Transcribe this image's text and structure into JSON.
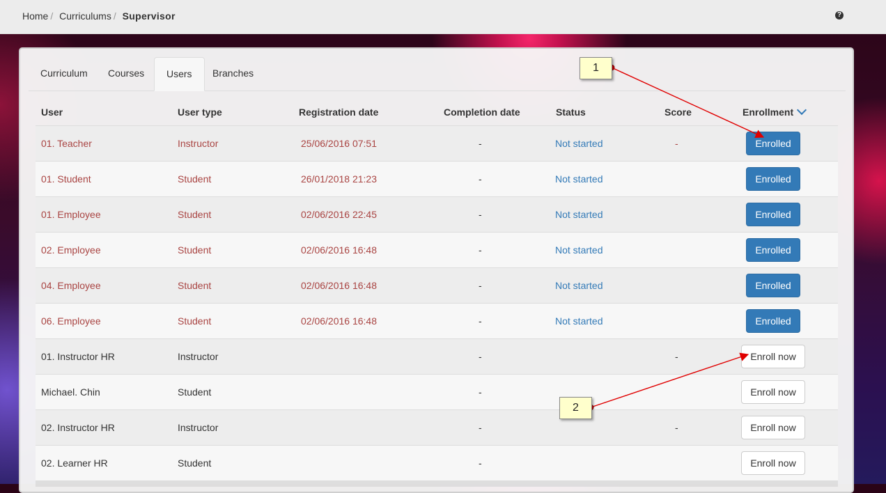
{
  "breadcrumb": {
    "home": "Home",
    "curriculums": "Curriculums",
    "current": "Supervisor"
  },
  "help_icon": "question-circle-icon",
  "tabs": [
    {
      "label": "Curriculum",
      "active": false
    },
    {
      "label": "Courses",
      "active": false
    },
    {
      "label": "Users",
      "active": true
    },
    {
      "label": "Branches",
      "active": false
    }
  ],
  "table": {
    "headers": {
      "user": "User",
      "type": "User type",
      "registration": "Registration date",
      "completion": "Completion date",
      "status": "Status",
      "score": "Score",
      "enrollment": "Enrollment"
    },
    "rows": [
      {
        "user": "01. Teacher",
        "type": "Instructor",
        "registration": "25/06/2016 07:51",
        "completion": "-",
        "status": "Not started",
        "score": "-",
        "action": "Enrolled"
      },
      {
        "user": "01. Student",
        "type": "Student",
        "registration": "26/01/2018 21:23",
        "completion": "-",
        "status": "Not started",
        "score": "",
        "action": "Enrolled"
      },
      {
        "user": "01. Employee",
        "type": "Student",
        "registration": "02/06/2016 22:45",
        "completion": "-",
        "status": "Not started",
        "score": "",
        "action": "Enrolled"
      },
      {
        "user": "02. Employee",
        "type": "Student",
        "registration": "02/06/2016 16:48",
        "completion": "-",
        "status": "Not started",
        "score": "",
        "action": "Enrolled"
      },
      {
        "user": "04. Employee",
        "type": "Student",
        "registration": "02/06/2016 16:48",
        "completion": "-",
        "status": "Not started",
        "score": "",
        "action": "Enrolled"
      },
      {
        "user": "06. Employee",
        "type": "Student",
        "registration": "02/06/2016 16:48",
        "completion": "-",
        "status": "Not started",
        "score": "",
        "action": "Enrolled"
      },
      {
        "user": "01. Instructor HR",
        "type": "Instructor",
        "registration": "",
        "completion": "-",
        "status": "",
        "score": "-",
        "action": "Enroll now"
      },
      {
        "user": "Michael. Chin",
        "type": "Student",
        "registration": "",
        "completion": "-",
        "status": "",
        "score": "",
        "action": "Enroll now"
      },
      {
        "user": "02. Instructor HR",
        "type": "Instructor",
        "registration": "",
        "completion": "-",
        "status": "",
        "score": "-",
        "action": "Enroll now"
      },
      {
        "user": "02. Learner HR",
        "type": "Student",
        "registration": "",
        "completion": "-",
        "status": "",
        "score": "",
        "action": "Enroll now"
      }
    ]
  },
  "annotations": [
    {
      "label": "1"
    },
    {
      "label": "2"
    }
  ],
  "colors": {
    "enrolled_text": "#a94442",
    "status": "#337ab7",
    "button_primary": "#337ab7",
    "arrow": "#e00000",
    "callout": "#ffffcc"
  }
}
